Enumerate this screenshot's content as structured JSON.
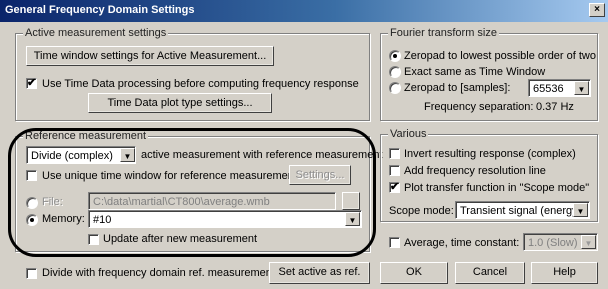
{
  "window": {
    "title": "General Frequency Domain Settings",
    "close_glyph": "×"
  },
  "active_measurement": {
    "legend": "Active measurement settings",
    "time_window_button": "Time window settings for Active Measurement...",
    "use_time_data_label": "Use Time Data processing before computing frequency response",
    "use_time_data_checked": true,
    "plot_type_button": "Time Data plot type settings..."
  },
  "fourier": {
    "legend": "Fourier transform size",
    "options": [
      "Zeropad to lowest possible order of two",
      "Exact same as Time Window",
      "Zeropad to [samples]:"
    ],
    "selected_index": 0,
    "samples_value": "65536",
    "separation_label": "Frequency separation:",
    "separation_value": "0.37 Hz"
  },
  "reference": {
    "legend": "Reference measurement",
    "mode_value": "Divide (complex)",
    "mode_suffix": "active measurement with reference measurement",
    "unique_window_label": "Use unique time window for reference measurement",
    "unique_window_checked": false,
    "settings_button": "Settings...",
    "file_label": "File:",
    "file_path": "C:\\data\\martial\\CT800\\average.wmb",
    "memory_label": "Memory:",
    "memory_value": "#10",
    "source_selected": "memory",
    "update_label": "Update after new measurement",
    "update_checked": false
  },
  "various": {
    "legend": "Various",
    "invert_label": "Invert resulting response (complex)",
    "invert_checked": false,
    "resolution_label": "Add frequency resolution line",
    "resolution_checked": false,
    "plot_transfer_label": "Plot transfer function in \"Scope mode\"",
    "plot_transfer_checked": true,
    "scope_mode_label": "Scope mode:",
    "scope_mode_value": "Transient signal (energy)"
  },
  "average": {
    "label": "Average, time constant:",
    "checked": false,
    "value": "1.0 (Slow)"
  },
  "bottom": {
    "divide_label": "Divide with frequency domain ref. measurement",
    "divide_checked": false,
    "set_active_button": "Set active as ref.",
    "ok_button": "OK",
    "cancel_button": "Cancel",
    "help_button": "Help"
  },
  "glyphs": {
    "check": "✔",
    "dropdown_arrow": "▼"
  },
  "colors": {
    "dialog_bg": "#d4d0c8",
    "title_gradient_start": "#0a246a",
    "highlight_ring": "#000000"
  }
}
